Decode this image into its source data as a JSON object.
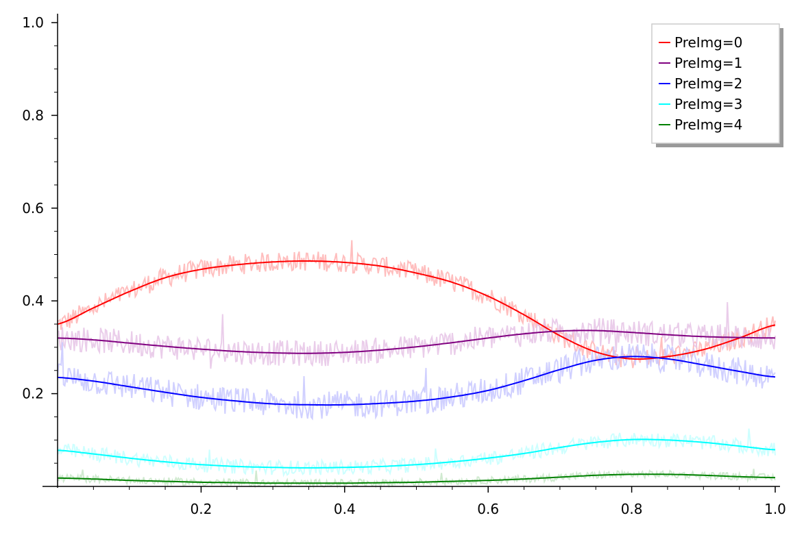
{
  "chart_data": {
    "type": "line",
    "title": "",
    "xlabel": "",
    "ylabel": "",
    "xlim": [
      0,
      1
    ],
    "ylim": [
      0,
      1
    ],
    "x_ticks": [
      "0.2",
      "0.4",
      "0.6",
      "0.8",
      "1.0"
    ],
    "y_ticks": [
      "0.2",
      "0.4",
      "0.6",
      "0.8",
      "1.0"
    ],
    "grid": false,
    "legend_position": "top-right",
    "series": [
      {
        "name": "PreImg=0",
        "color": "#ff0000",
        "noise_color": "#ffb3b3",
        "x": [
          0.0,
          0.05,
          0.1,
          0.15,
          0.2,
          0.25,
          0.3,
          0.35,
          0.4,
          0.45,
          0.5,
          0.55,
          0.6,
          0.65,
          0.7,
          0.75,
          0.8,
          0.85,
          0.9,
          0.95,
          1.0
        ],
        "values": [
          0.35,
          0.385,
          0.42,
          0.45,
          0.468,
          0.478,
          0.484,
          0.486,
          0.483,
          0.475,
          0.46,
          0.44,
          0.41,
          0.37,
          0.325,
          0.29,
          0.275,
          0.28,
          0.295,
          0.32,
          0.348
        ]
      },
      {
        "name": "PreImg=1",
        "color": "#800080",
        "noise_color": "#e6c4e6",
        "x": [
          0.0,
          0.05,
          0.1,
          0.15,
          0.2,
          0.25,
          0.3,
          0.35,
          0.4,
          0.45,
          0.5,
          0.55,
          0.6,
          0.65,
          0.7,
          0.75,
          0.8,
          0.85,
          0.9,
          0.95,
          1.0
        ],
        "values": [
          0.32,
          0.316,
          0.309,
          0.302,
          0.296,
          0.291,
          0.288,
          0.287,
          0.289,
          0.294,
          0.301,
          0.31,
          0.32,
          0.329,
          0.335,
          0.336,
          0.332,
          0.327,
          0.323,
          0.321,
          0.32
        ]
      },
      {
        "name": "PreImg=2",
        "color": "#0000ff",
        "noise_color": "#c8c8ff",
        "x": [
          0.0,
          0.05,
          0.1,
          0.15,
          0.2,
          0.25,
          0.3,
          0.35,
          0.4,
          0.45,
          0.5,
          0.55,
          0.6,
          0.65,
          0.7,
          0.75,
          0.8,
          0.85,
          0.9,
          0.95,
          1.0
        ],
        "values": [
          0.235,
          0.227,
          0.215,
          0.203,
          0.192,
          0.184,
          0.178,
          0.176,
          0.176,
          0.179,
          0.184,
          0.193,
          0.207,
          0.228,
          0.252,
          0.272,
          0.28,
          0.275,
          0.262,
          0.248,
          0.236
        ]
      },
      {
        "name": "PreImg=3",
        "color": "#00ffff",
        "noise_color": "#c4ffff",
        "x": [
          0.0,
          0.05,
          0.1,
          0.15,
          0.2,
          0.25,
          0.3,
          0.35,
          0.4,
          0.45,
          0.5,
          0.55,
          0.6,
          0.65,
          0.7,
          0.75,
          0.8,
          0.85,
          0.9,
          0.95,
          1.0
        ],
        "values": [
          0.078,
          0.07,
          0.061,
          0.053,
          0.047,
          0.043,
          0.041,
          0.04,
          0.041,
          0.043,
          0.047,
          0.053,
          0.061,
          0.071,
          0.084,
          0.095,
          0.101,
          0.1,
          0.095,
          0.087,
          0.079
        ]
      },
      {
        "name": "PreImg=4",
        "color": "#008000",
        "noise_color": "#c8e6c8",
        "x": [
          0.0,
          0.05,
          0.1,
          0.15,
          0.2,
          0.25,
          0.3,
          0.35,
          0.4,
          0.45,
          0.5,
          0.55,
          0.6,
          0.65,
          0.7,
          0.75,
          0.8,
          0.85,
          0.9,
          0.95,
          1.0
        ],
        "values": [
          0.018,
          0.016,
          0.013,
          0.011,
          0.009,
          0.008,
          0.007,
          0.007,
          0.007,
          0.008,
          0.009,
          0.011,
          0.013,
          0.016,
          0.02,
          0.024,
          0.026,
          0.026,
          0.024,
          0.021,
          0.019
        ]
      }
    ]
  }
}
